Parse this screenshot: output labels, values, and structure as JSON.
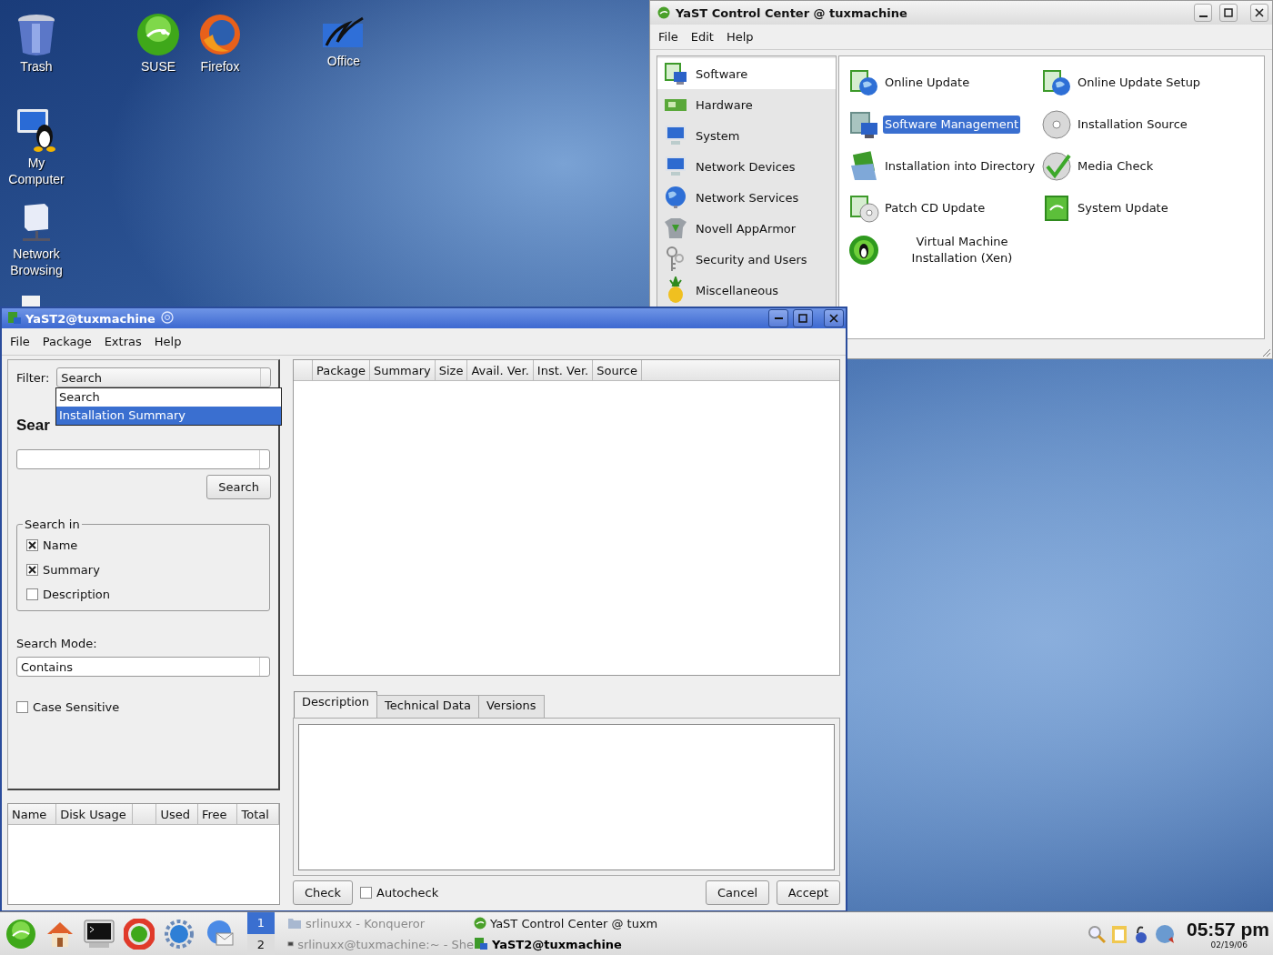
{
  "desktop_icons": [
    {
      "label": "Trash",
      "kind": "trash"
    },
    {
      "label": "SUSE",
      "kind": "suse"
    },
    {
      "label": "Firefox",
      "kind": "firefox"
    },
    {
      "label": "Office",
      "kind": "office"
    },
    {
      "label": "My Computer",
      "kind": "computer"
    },
    {
      "label": "Network Browsing",
      "kind": "network"
    }
  ],
  "control_center": {
    "title": "YaST Control Center @ tuxmachine",
    "menu": [
      "File",
      "Edit",
      "Help"
    ],
    "categories": [
      {
        "label": "Software",
        "selected": true,
        "kind": "package"
      },
      {
        "label": "Hardware",
        "selected": false,
        "kind": "card"
      },
      {
        "label": "System",
        "selected": false,
        "kind": "monitor"
      },
      {
        "label": "Network Devices",
        "selected": false,
        "kind": "monitor"
      },
      {
        "label": "Network Services",
        "selected": false,
        "kind": "globe"
      },
      {
        "label": "Novell AppArmor",
        "selected": false,
        "kind": "shield"
      },
      {
        "label": "Security and Users",
        "selected": false,
        "kind": "keys"
      },
      {
        "label": "Miscellaneous",
        "selected": false,
        "kind": "pineapple"
      }
    ],
    "modules": [
      {
        "label": "Online Update",
        "selected": false,
        "kind": "globe-box"
      },
      {
        "label": "Online Update Setup",
        "selected": false,
        "kind": "globe-box"
      },
      {
        "label": "Software Management",
        "selected": true,
        "kind": "package"
      },
      {
        "label": "Installation Source",
        "selected": false,
        "kind": "disc"
      },
      {
        "label": "Installation into Directory",
        "selected": false,
        "kind": "folder"
      },
      {
        "label": "Media Check",
        "selected": false,
        "kind": "check-disc"
      },
      {
        "label": "Patch CD Update",
        "selected": false,
        "kind": "disc-box"
      },
      {
        "label": "System Update",
        "selected": false,
        "kind": "box"
      },
      {
        "label": "Virtual Machine Installation (Xen)",
        "selected": false,
        "kind": "penguin"
      }
    ]
  },
  "package_manager": {
    "title": "YaST2@tuxmachine",
    "menu": [
      "File",
      "Package",
      "Extras",
      "Help"
    ],
    "filter_label": "Filter:",
    "filter_value": "Search",
    "filter_options": [
      {
        "label": "Search",
        "selected": false
      },
      {
        "label": "Installation Summary",
        "selected": true
      }
    ],
    "search_heading": "Sear",
    "search_button": "Search",
    "search_in": {
      "title": "Search in",
      "options": [
        {
          "label": "Name",
          "checked": true
        },
        {
          "label": "Summary",
          "checked": true
        },
        {
          "label": "Description",
          "checked": false
        }
      ]
    },
    "search_mode_label": "Search Mode:",
    "search_mode_value": "Contains",
    "case_sensitive": {
      "label": "Case Sensitive",
      "checked": false
    },
    "package_columns": [
      "Package",
      "Summary",
      "Size",
      "Avail. Ver.",
      "Inst. Ver.",
      "Source"
    ],
    "disk_columns": [
      "Name",
      "Disk Usage",
      "",
      "Used",
      "Free",
      "Total"
    ],
    "tabs": [
      {
        "label": "Description",
        "selected": true
      },
      {
        "label": "Technical Data",
        "selected": false
      },
      {
        "label": "Versions",
        "selected": false
      }
    ],
    "check_button": "Check",
    "autocheck": {
      "label": "Autocheck",
      "checked": false
    },
    "cancel_button": "Cancel",
    "accept_button": "Accept"
  },
  "taskbar": {
    "pager": [
      {
        "label": "1",
        "selected": true
      },
      {
        "label": "2",
        "selected": false
      }
    ],
    "tasks": [
      {
        "label": "srlinuxx - Konqueror",
        "active": false,
        "minimized": true,
        "kind": "folder"
      },
      {
        "label": "YaST Control Center @ tuxm",
        "active": false,
        "minimized": false,
        "kind": "suse"
      },
      {
        "label": "srlinuxx@tuxmachine:~ - She",
        "active": false,
        "minimized": true,
        "kind": "terminal"
      },
      {
        "label": "YaST2@tuxmachine",
        "active": true,
        "minimized": false,
        "kind": "package"
      }
    ],
    "clock": "05:57 pm",
    "date": "02/19/06"
  }
}
